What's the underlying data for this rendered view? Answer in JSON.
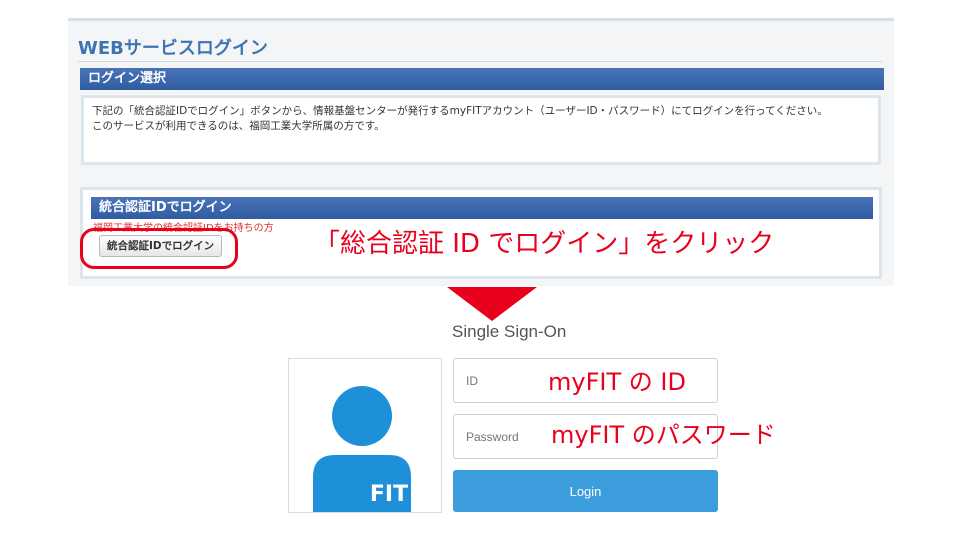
{
  "top_panel": {
    "page_title": "WEBサービスログイン",
    "section1": {
      "heading": "ログイン選択",
      "line1": "下記の「統合認証IDでログイン」ボタンから、情報基盤センターが発行するmyFITアカウント（ユーザーID・パスワード）にてログインを行ってください。",
      "line2": "このサービスが利用できるのは、福岡工業大学所属の方です。"
    },
    "section2": {
      "heading": "統合認証IDでログイン",
      "note": "福岡工業大学の統合認証IDをお持ちの方",
      "button_label": "統合認証IDでログイン"
    }
  },
  "annotations": {
    "click_instruction": "「総合認証 ID でログイン」をクリック",
    "id_hint": "myFIT の ID",
    "password_hint": "myFIT のパスワード"
  },
  "sso": {
    "title": "Single Sign-On",
    "logo_text": "FIT",
    "id_placeholder": "ID",
    "password_placeholder": "Password",
    "login_label": "Login"
  },
  "colors": {
    "header_blue": "#3f74b2",
    "login_button": "#3b9ddb",
    "avatar_blue": "#1e8fd9",
    "annotation_red": "#e8001c"
  }
}
